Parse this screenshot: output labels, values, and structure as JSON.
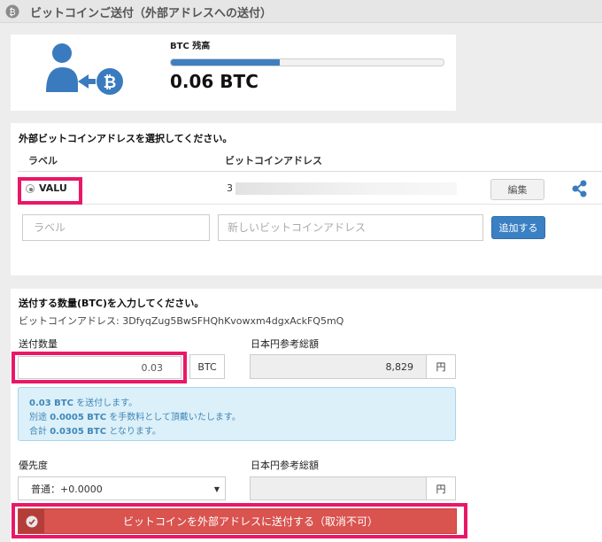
{
  "header": {
    "title": "ビットコインご送付（外部アドレスへの送付）"
  },
  "balance": {
    "label": "BTC 残高",
    "value": "0.06 BTC",
    "bar_fraction": 0.4
  },
  "address_section": {
    "title": "外部ビットコインアドレスを選択してください。",
    "col_label": "ラベル",
    "col_address": "ビットコインアドレス",
    "row": {
      "label": "VALU",
      "address_visible": "3",
      "edit_label": "編集"
    },
    "label_placeholder": "ラベル",
    "address_placeholder": "新しいビットコインアドレス",
    "add_label": "追加する"
  },
  "amount_section": {
    "title": "送付する数量(BTC)を入力してください。",
    "address_line": "ビットコインアドレス: 3DfyqZug5BwSFHQhKvowxm4dgxAckFQ5mQ",
    "amount_label": "送付数量",
    "amount_value": "0.03",
    "amount_unit": "BTC",
    "yen_label": "日本円参考総額",
    "yen_value": "8,829",
    "yen_unit": "円",
    "info": {
      "line1_strong": "0.03 BTC",
      "line1_rest": " を送付します。",
      "line2_pre": "別途 ",
      "line2_strong": "0.0005 BTC",
      "line2_rest": " を手数料として頂戴いたします。",
      "line3_pre": "合計 ",
      "line3_strong": "0.0305 BTC",
      "line3_rest": " となります。"
    },
    "priority_label": "優先度",
    "priority_value": "普通：+0.0000",
    "yen_label2": "日本円参考総額",
    "yen_unit2": "円",
    "send_label": "ビットコインを外部アドレスに送付する（取消不可）"
  },
  "colors": {
    "accent": "#3f7fc1",
    "highlight": "#ea1767",
    "danger": "#d9534f",
    "info_bg": "#dcf0f9"
  }
}
